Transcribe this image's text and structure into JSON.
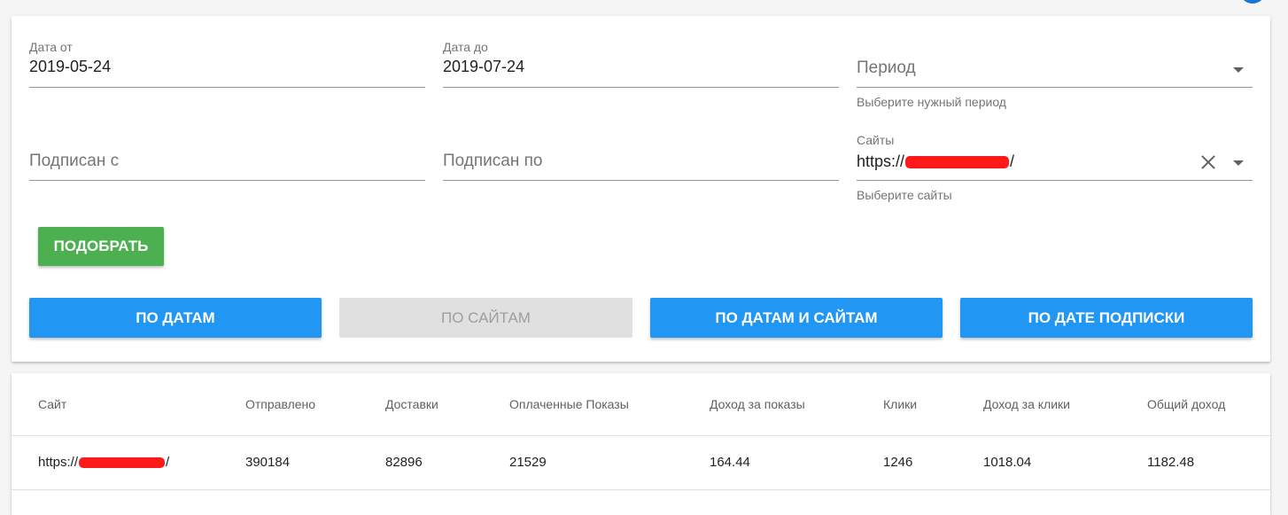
{
  "filters": {
    "date_from": {
      "label": "Дата от",
      "value": "2019-05-24"
    },
    "date_to": {
      "label": "Дата до",
      "value": "2019-07-24"
    },
    "period": {
      "placeholder": "Период",
      "hint": "Выберите нужный период"
    },
    "signed_from": {
      "placeholder": "Подписан с"
    },
    "signed_to": {
      "placeholder": "Подписан по"
    },
    "sites": {
      "label": "Сайты",
      "value_prefix": "https://",
      "value_suffix": "/",
      "hint": "Выберите сайты"
    }
  },
  "buttons": {
    "select": "Подобрать",
    "by_dates": "По датам",
    "by_sites": "По сайтам",
    "by_dates_and_sites": "По датам и сайтам",
    "by_subscription_date": "По дате подписки"
  },
  "table": {
    "columns": [
      "Сайт",
      "Отправлено",
      "Доставки",
      "Оплаченные Показы",
      "Доход за показы",
      "Клики",
      "Доход за клики",
      "Общий доход"
    ],
    "rows": [
      {
        "site_prefix": "https://",
        "site_suffix": "/",
        "sent": "390184",
        "deliveries": "82896",
        "paid_impressions": "21529",
        "impression_income": "164.44",
        "clicks": "1246",
        "click_income": "1018.04",
        "total_income": "1182.48"
      }
    ]
  },
  "colors": {
    "accent": "#2196f3",
    "success": "#4caf50",
    "redaction": "#ff1a1a"
  }
}
